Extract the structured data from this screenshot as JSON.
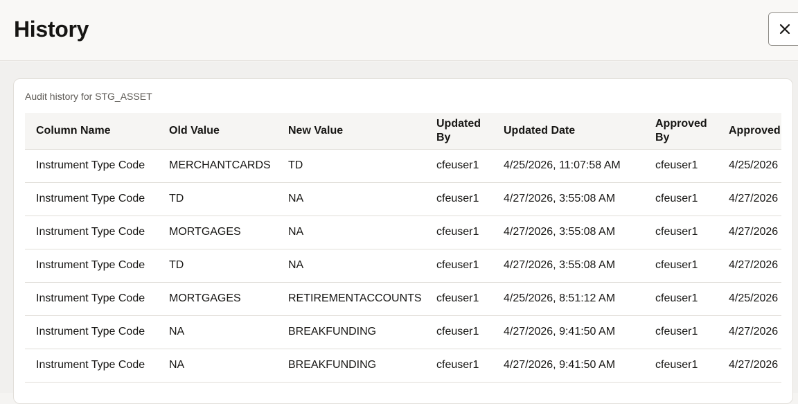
{
  "dialog": {
    "title": "History",
    "close_label": "Close"
  },
  "audit": {
    "caption": "Audit history for STG_ASSET",
    "columns": [
      "Column Name",
      "Old Value",
      "New Value",
      "Updated By",
      "Updated Date",
      "Approved By",
      "Approved"
    ],
    "rows": [
      [
        "Instrument Type Code",
        "MERCHANTCARDS",
        "TD",
        "cfeuser1",
        "4/25/2026, 11:07:58 AM",
        "cfeuser1",
        "4/25/2026"
      ],
      [
        "Instrument Type Code",
        "TD",
        "NA",
        "cfeuser1",
        "4/27/2026, 3:55:08 AM",
        "cfeuser1",
        "4/27/2026"
      ],
      [
        "Instrument Type Code",
        "MORTGAGES",
        "NA",
        "cfeuser1",
        "4/27/2026, 3:55:08 AM",
        "cfeuser1",
        "4/27/2026"
      ],
      [
        "Instrument Type Code",
        "TD",
        "NA",
        "cfeuser1",
        "4/27/2026, 3:55:08 AM",
        "cfeuser1",
        "4/27/2026"
      ],
      [
        "Instrument Type Code",
        "MORTGAGES",
        "RETIREMENTACCOUNTS",
        "cfeuser1",
        "4/25/2026, 8:51:12 AM",
        "cfeuser1",
        "4/25/2026"
      ],
      [
        "Instrument Type Code",
        "NA",
        "BREAKFUNDING",
        "cfeuser1",
        "4/27/2026, 9:41:50 AM",
        "cfeuser1",
        "4/27/2026"
      ],
      [
        "Instrument Type Code",
        "NA",
        "BREAKFUNDING",
        "cfeuser1",
        "4/27/2026, 9:41:50 AM",
        "cfeuser1",
        "4/27/2026"
      ]
    ]
  },
  "icons": {
    "close": "close-icon"
  }
}
